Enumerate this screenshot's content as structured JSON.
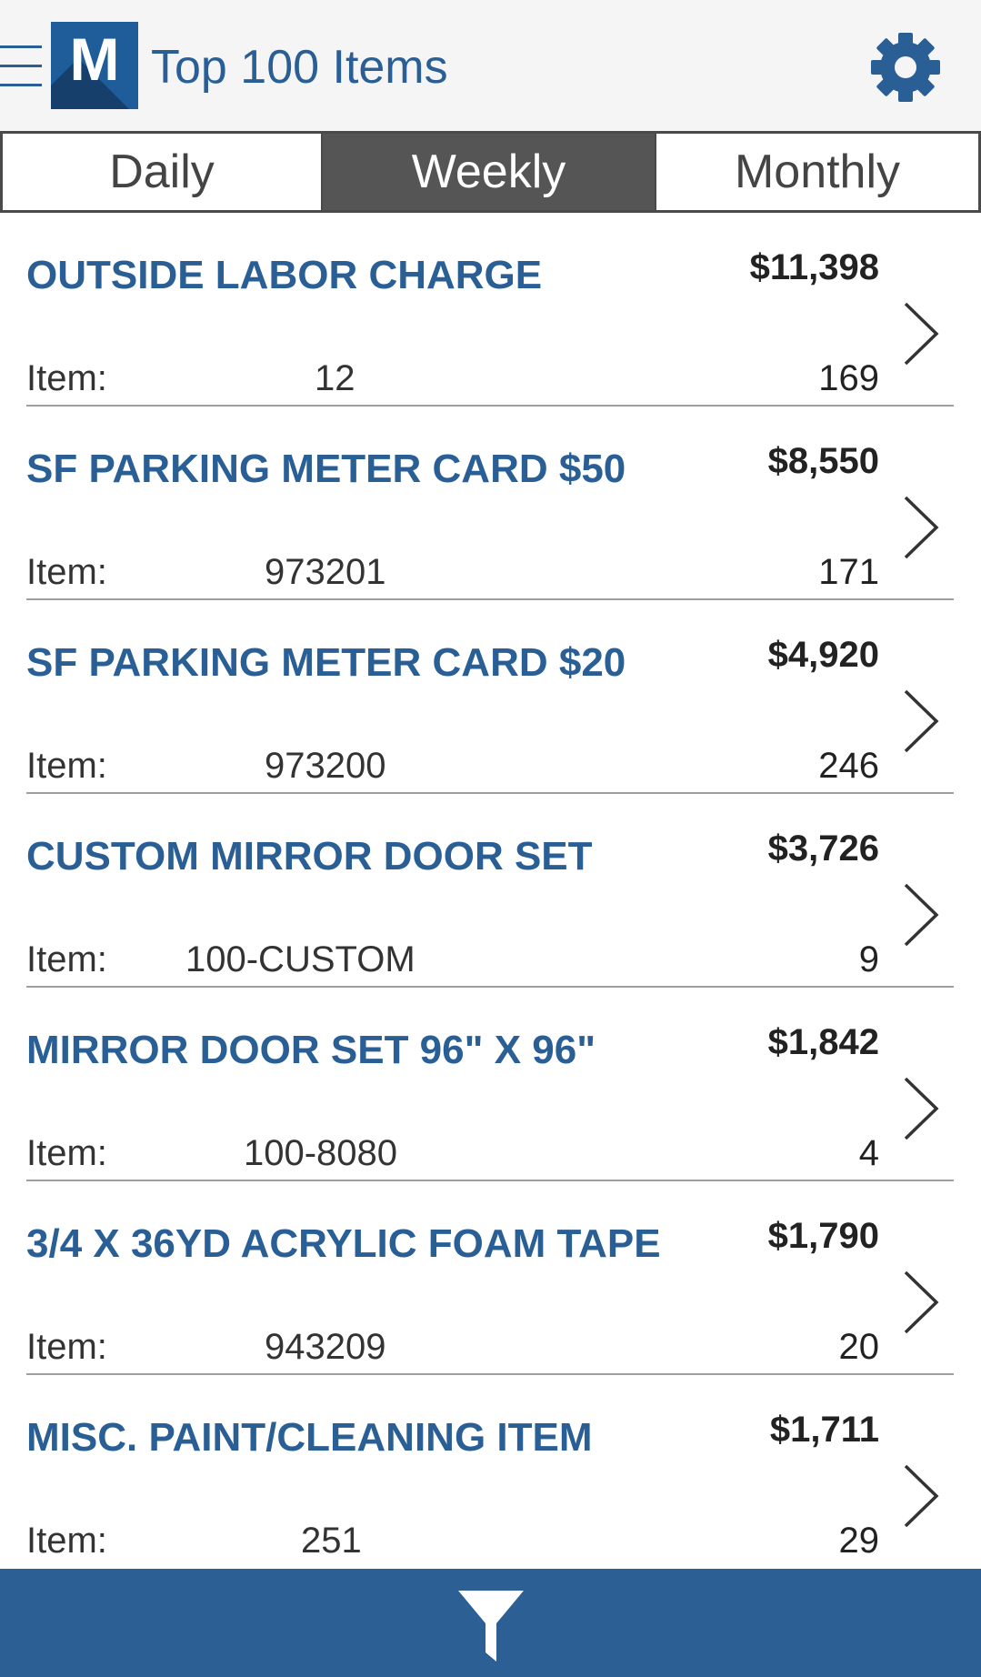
{
  "header": {
    "logo_letter": "M",
    "title": "Top 100 Items"
  },
  "tabs": [
    {
      "label": "Daily",
      "selected": false
    },
    {
      "label": "Weekly",
      "selected": true
    },
    {
      "label": "Monthly",
      "selected": false
    }
  ],
  "items": [
    {
      "name": "OUTSIDE LABOR CHARGE",
      "amount": "$11,398",
      "item_label": "Item:",
      "item_number": "12",
      "quantity": "169"
    },
    {
      "name": "SF PARKING METER CARD $50",
      "amount": "$8,550",
      "item_label": "Item:",
      "item_number": "973201",
      "quantity": "171"
    },
    {
      "name": "SF PARKING METER CARD $20",
      "amount": "$4,920",
      "item_label": "Item:",
      "item_number": "973200",
      "quantity": "246"
    },
    {
      "name": "CUSTOM MIRROR DOOR SET",
      "amount": "$3,726",
      "item_label": "Item:",
      "item_number": "100-CUSTOM",
      "quantity": "9"
    },
    {
      "name": "MIRROR DOOR SET 96\" X 96\"",
      "amount": "$1,842",
      "item_label": "Item:",
      "item_number": "100-8080",
      "quantity": "4"
    },
    {
      "name": "3/4 X 36YD ACRYLIC FOAM TAPE",
      "amount": "$1,790",
      "item_label": "Item:",
      "item_number": "943209",
      "quantity": "20"
    },
    {
      "name": "MISC. PAINT/CLEANING ITEM",
      "amount": "$1,711",
      "item_label": "Item:",
      "item_number": "251",
      "quantity": "29"
    }
  ],
  "colors": {
    "brand_blue": "#2a5f96",
    "bottom_bar": "#2c5f94",
    "selected_tab": "#555555"
  },
  "icons": {
    "menu": "menu-icon",
    "settings": "gear-icon",
    "row_action": "chevron-right-icon",
    "bottom_action": "filter-icon"
  }
}
